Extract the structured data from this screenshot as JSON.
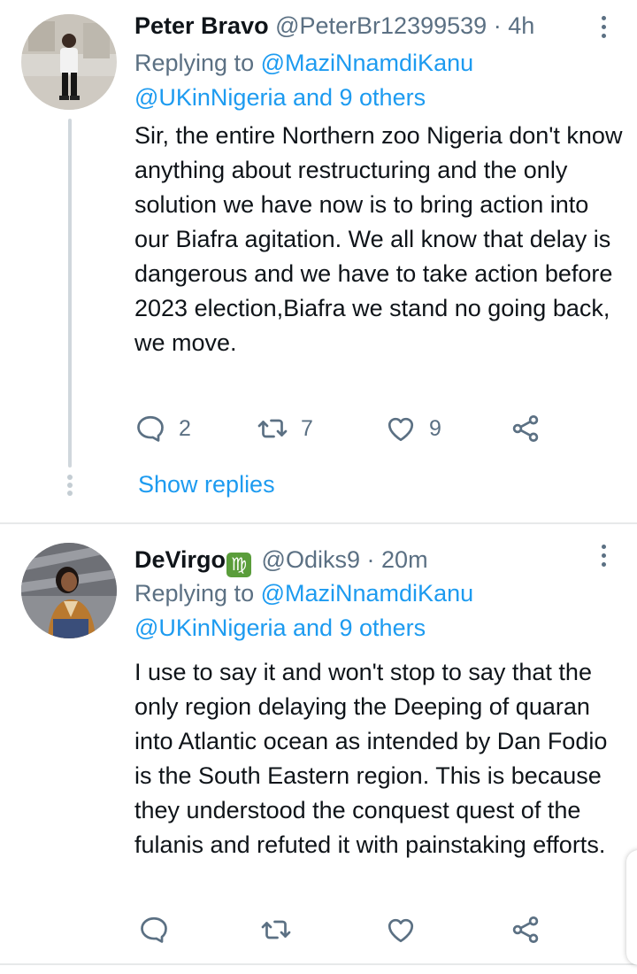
{
  "tweets": [
    {
      "name": "Peter Bravo",
      "handle": "@PeterBr12399539",
      "time": "4h",
      "replying_prefix": "Replying to",
      "replying_user": "@MaziNnamdiKanu",
      "replying_rest": "@UKinNigeria and 9 others",
      "text": "Sir, the entire Northern zoo Nigeria don't know anything about restructuring and the only solution we have now is to bring action into our Biafra agitation. We all know that delay is dangerous and we have to take action before 2023 election,Biafra we stand no going back, we move.",
      "reply_count": "2",
      "retweet_count": "7",
      "like_count": "9",
      "show_replies": "Show replies"
    },
    {
      "name": "DeVirgo",
      "name_emoji": "♍",
      "handle": "@Odiks9",
      "time": "20m",
      "replying_prefix": "Replying to",
      "replying_user": "@MaziNnamdiKanu",
      "replying_rest": "@UKinNigeria and 9 others",
      "text": "I use to say it and won't stop to say that the only region delaying the Deeping of quaran into Atlantic ocean as intended by Dan Fodio is the South Eastern region. This is because they understood the conquest quest of the fulanis and refuted it with painstaking efforts."
    }
  ],
  "icons": {
    "reply": "reply-icon",
    "retweet": "retweet-icon",
    "like": "heart-icon",
    "share": "share-icon",
    "more": "more-vertical-icon"
  },
  "colors": {
    "accent": "#1d9bf0",
    "secondary_text": "#5b7083",
    "zodiac_badge": "#5a9d3b"
  }
}
